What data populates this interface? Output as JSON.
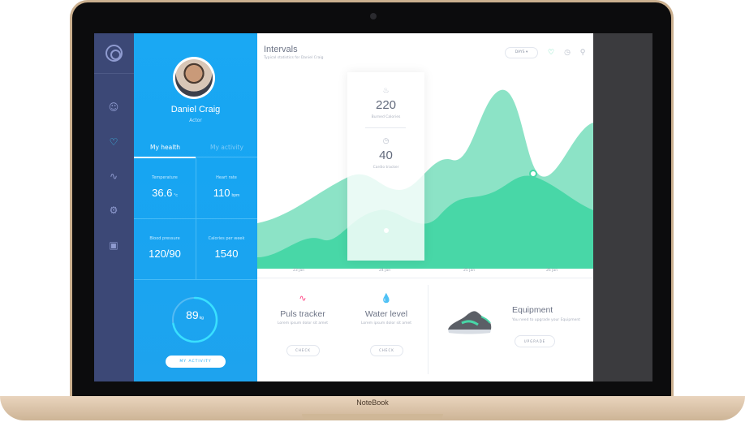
{
  "device": {
    "brand": "NoteBook"
  },
  "sidebar": {
    "icons": [
      "logo-icon",
      "user-icon",
      "heart-icon",
      "activity-icon",
      "settings-icon",
      "briefcase-icon"
    ]
  },
  "profile": {
    "name": "Daniel Craig",
    "role": "Actor",
    "tabs": [
      "My health",
      "My activity"
    ],
    "stats": [
      {
        "label": "Temperature",
        "value": "36.6",
        "unit": "°c"
      },
      {
        "label": "Heart rate",
        "value": "110",
        "unit": "bpm"
      },
      {
        "label": "Blood pressure",
        "value": "120/90",
        "unit": ""
      },
      {
        "label": "Calories per week",
        "value": "1540",
        "unit": ""
      }
    ],
    "weight": {
      "value": "89",
      "unit": "kg",
      "progress": 0.72
    },
    "activity_button": "MY ACTIVITY"
  },
  "main": {
    "title": "Intervals",
    "subtitle": "Typical statistics for Daniel Craig",
    "range_select": "DAYS",
    "card": {
      "calories": {
        "value": "220",
        "label": "Burned Calories"
      },
      "cardio": {
        "value": "40",
        "label": "Cardio tracker"
      }
    },
    "x_labels": [
      "23 Jan",
      "24 Jan",
      "25 Jan",
      "26 Jan"
    ],
    "trackers": [
      {
        "name": "Puls tracker",
        "desc": "Lorem ipsum dolor sit amet",
        "button": "CHECK"
      },
      {
        "name": "Water level",
        "desc": "Lorem ipsum dolor sit amet",
        "button": "CHECK"
      }
    ],
    "equipment": {
      "title": "Equipment",
      "desc": "You need to upgrade your Equipment",
      "button": "UPGRADE"
    }
  },
  "colors": {
    "accent": "#1aa8f3",
    "chart": "#48d7a7",
    "sidebar": "#3c4876"
  }
}
